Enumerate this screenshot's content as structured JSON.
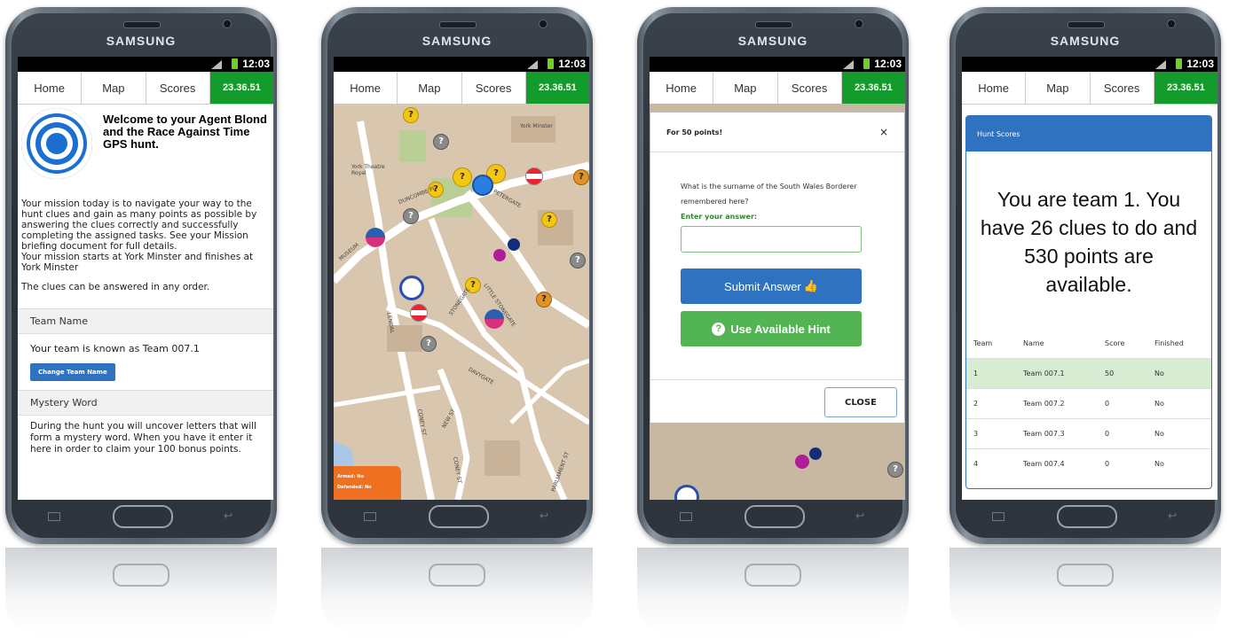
{
  "phones": [
    {
      "brand": "SAMSUNG",
      "time": "12:03",
      "nav": [
        "Home",
        "Map",
        "Scores"
      ],
      "timer": "23.36.51"
    },
    {
      "brand": "SAMSUNG",
      "time": "12:03",
      "nav": [
        "Home",
        "Map",
        "Scores"
      ],
      "timer": "23.36.51"
    },
    {
      "brand": "SAMSUNG",
      "time": "12:03",
      "nav": [
        "Home",
        "Map",
        "Scores"
      ],
      "timer": "23.36.51"
    },
    {
      "brand": "SAMSUNG",
      "time": "12:03",
      "nav": [
        "Home",
        "Map",
        "Scores"
      ],
      "timer": "23.36.51"
    }
  ],
  "home": {
    "welcome": "Welcome to your Agent Blond and the Race Against Time GPS hunt.",
    "mission": "Your mission today is to navigate your way to the hunt clues and gain as many points as possible by answering the clues correctly and successfully completing the assigned tasks. See your Mission briefing document for full details.",
    "start": "Your mission starts at York Minster and finishes at York Minster",
    "order": "The clues can be answered in any order.",
    "team_header": "Team Name",
    "team_text": "Your team is known as Team 007.1",
    "change_button": "Change Team Name",
    "mystery_header": "Mystery Word",
    "mystery_text": "During the hunt you will uncover letters that will form a mystery word. When you have it enter it here in order to claim your 100 bonus points."
  },
  "map": {
    "labels": [
      "York Minster",
      "York Theatre Royal",
      "DUNCOMBE PL",
      "PETERGATE",
      "MUSEUM",
      "STONEGATE",
      "LITTLE STONEGATE",
      "LENDAL",
      "DAVYGATE",
      "CONEY ST",
      "NEW ST",
      "CONEY ST",
      "PARLIAMENT ST"
    ],
    "status_lines": [
      "Armed: No",
      "Defended: No"
    ]
  },
  "question": {
    "title": "For 50 points!",
    "close_x": "×",
    "text": "What is the surname of the South Wales Borderer remembered here?",
    "answer_label": "Enter your answer:",
    "submit": "Submit Answer",
    "hint": "Use Available Hint",
    "close": "CLOSE"
  },
  "scores": {
    "panel_title": "Hunt Scores",
    "message": "You are team 1. You have 26 clues to do and 530 points are available.",
    "columns": [
      "Team",
      "Name",
      "Score",
      "Finished"
    ],
    "rows": [
      [
        "1",
        "Team 007.1",
        "50",
        "No"
      ],
      [
        "2",
        "Team 007.2",
        "0",
        "No"
      ],
      [
        "3",
        "Team 007.3",
        "0",
        "No"
      ],
      [
        "4",
        "Team 007.4",
        "0",
        "No"
      ]
    ]
  },
  "colors": {
    "timer_bg": "#139c2b",
    "accent_blue": "#2f73c0",
    "hint_green": "#52b452",
    "map_land": "#d8c6ae"
  }
}
